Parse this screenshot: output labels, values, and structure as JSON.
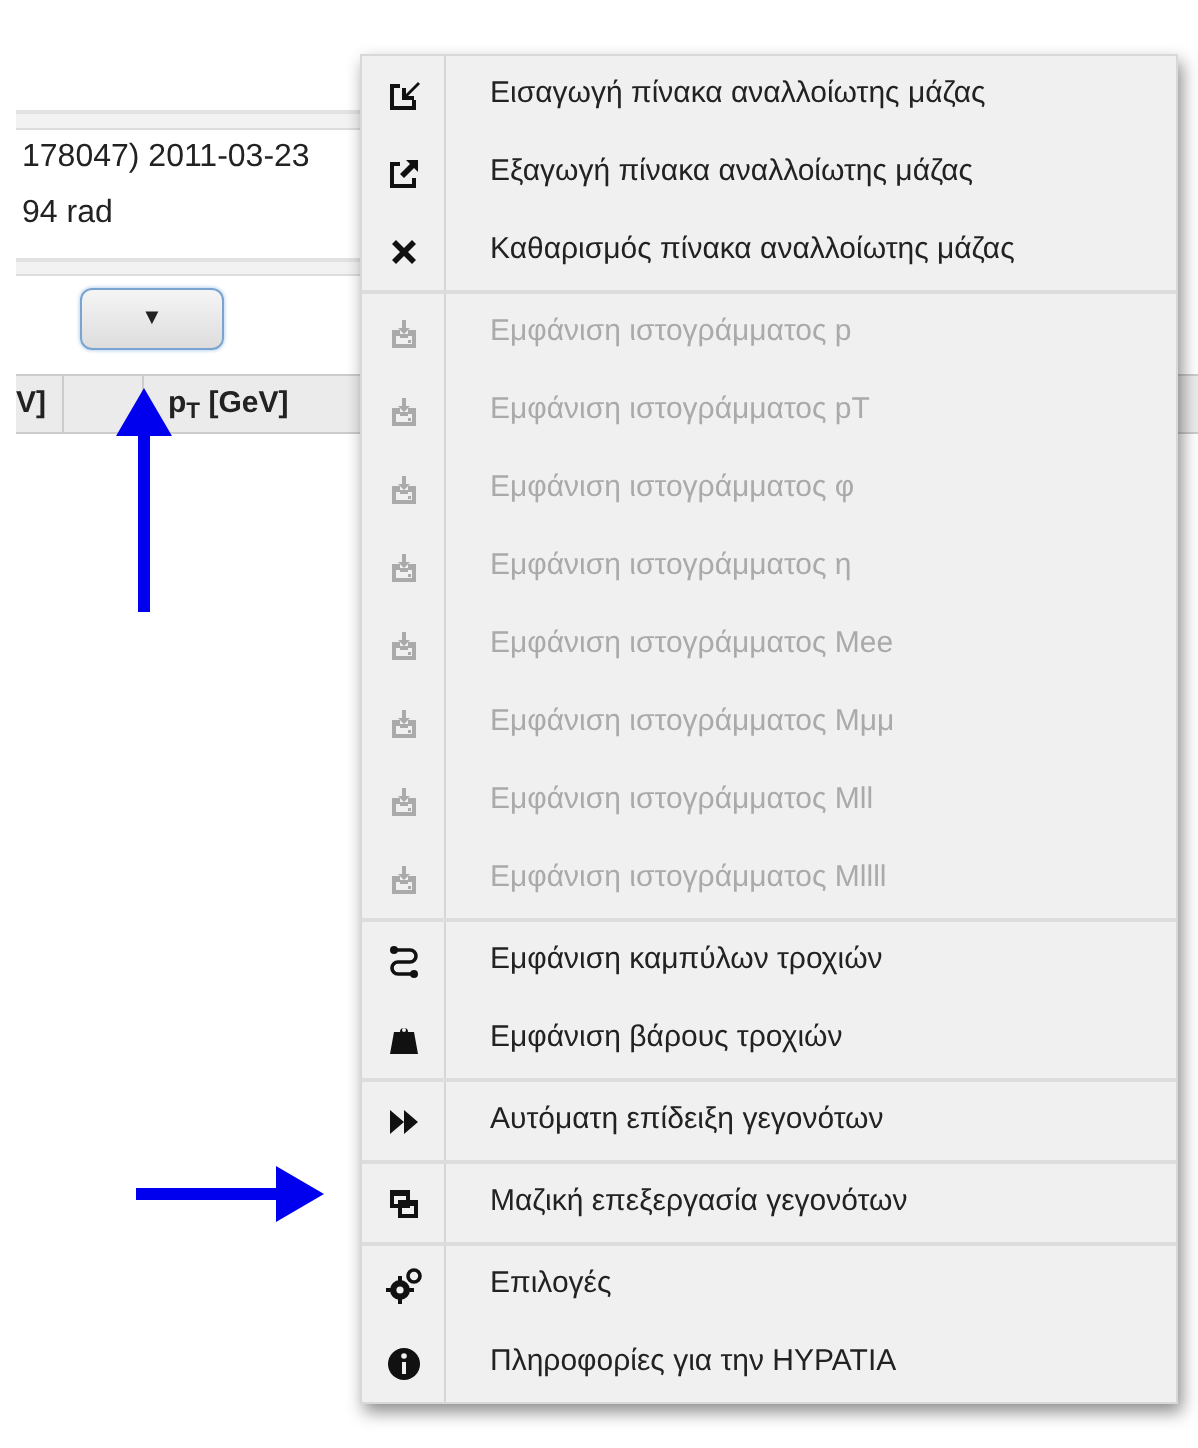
{
  "info_lines": [
    "178047) 2011-03-23",
    "94 rad"
  ],
  "toggle_button": {
    "label": "▼"
  },
  "table": {
    "columns": [
      "V]",
      "",
      "p$_{T}$ [GeV]"
    ]
  },
  "menu": {
    "groups": [
      {
        "items": [
          {
            "label": "Εισαγωγή πίνακα αναλλοίωτης μάζας",
            "kind": "import",
            "disabled": false
          },
          {
            "label": "Εξαγωγή πίνακα αναλλοίωτης μάζας",
            "kind": "export",
            "disabled": false
          },
          {
            "label": "Καθαρισμός πίνακα αναλλοίωτης μάζας",
            "kind": "clear",
            "disabled": false
          }
        ]
      },
      {
        "items": [
          {
            "label": "Εμφάνιση ιστογράμματος p",
            "kind": "histogram",
            "disabled": true
          },
          {
            "label": "Εμφάνιση ιστογράμματος pT",
            "kind": "histogram",
            "disabled": true
          },
          {
            "label": "Εμφάνιση ιστογράμματος φ",
            "kind": "histogram",
            "disabled": true
          },
          {
            "label": "Εμφάνιση ιστογράμματος η",
            "kind": "histogram",
            "disabled": true
          },
          {
            "label": "Εμφάνιση ιστογράμματος Mee",
            "kind": "histogram",
            "disabled": true
          },
          {
            "label": "Εμφάνιση ιστογράμματος Mμμ",
            "kind": "histogram",
            "disabled": true
          },
          {
            "label": "Εμφάνιση ιστογράμματος Mll",
            "kind": "histogram",
            "disabled": true
          },
          {
            "label": "Εμφάνιση ιστογράμματος Mllll",
            "kind": "histogram",
            "disabled": true
          }
        ]
      },
      {
        "items": [
          {
            "label": "Εμφάνιση καμπύλων τροχιών",
            "kind": "curves",
            "disabled": false
          },
          {
            "label": "Εμφάνιση βάρους τροχιών",
            "kind": "weight",
            "disabled": false
          }
        ]
      },
      {
        "items": [
          {
            "label": "Αυτόματη επίδειξη γεγονότων",
            "kind": "autoplay",
            "disabled": false
          }
        ]
      },
      {
        "items": [
          {
            "label": "Μαζική επεξεργασία γεγονότων",
            "kind": "batch",
            "disabled": false
          }
        ]
      },
      {
        "items": [
          {
            "label": "Επιλογές",
            "kind": "options",
            "disabled": false
          },
          {
            "label": "Πληροφορίες για την HYPATIA",
            "kind": "info",
            "disabled": false
          }
        ]
      }
    ]
  }
}
